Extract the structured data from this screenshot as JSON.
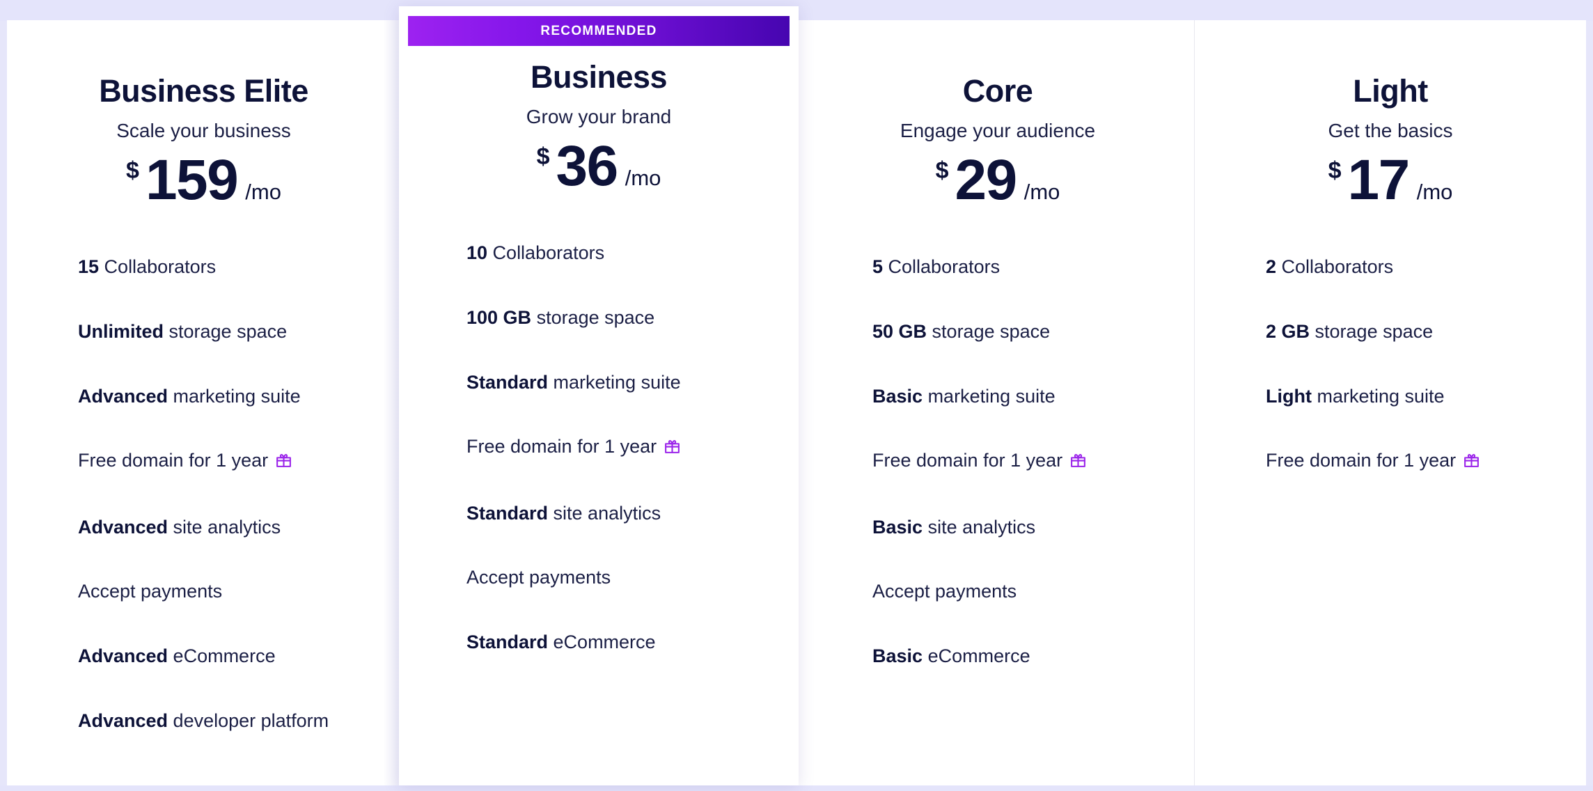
{
  "theme": {
    "page_background": "#e4e4fb",
    "card_background": "#ffffff",
    "text_primary": "#0d1238",
    "text_body": "#1b1f45",
    "ribbon_gradient_start": "#9d22f0",
    "ribbon_gradient_end": "#4605b0",
    "gift_icon_color": "#9b24ea"
  },
  "ribbon": {
    "label": "RECOMMENDED"
  },
  "plans": [
    {
      "id": "business-elite",
      "name": "Business Elite",
      "tagline": "Scale your business",
      "currency": "$",
      "price": "159",
      "period": "/mo",
      "recommended": false,
      "features": [
        {
          "lead": "15",
          "rest": " Collaborators",
          "gift": false
        },
        {
          "lead": "Unlimited",
          "rest": " storage space",
          "gift": false
        },
        {
          "lead": "Advanced",
          "rest": " marketing suite",
          "gift": false
        },
        {
          "lead": "",
          "rest": "Free domain for 1 year",
          "gift": true
        },
        {
          "lead": "Advanced",
          "rest": " site analytics",
          "gift": false
        },
        {
          "lead": "",
          "rest": "Accept payments",
          "gift": false
        },
        {
          "lead": "Advanced",
          "rest": " eCommerce",
          "gift": false
        },
        {
          "lead": "Advanced",
          "rest": " developer platform",
          "gift": false
        }
      ]
    },
    {
      "id": "business",
      "name": "Business",
      "tagline": "Grow your brand",
      "currency": "$",
      "price": "36",
      "period": "/mo",
      "recommended": true,
      "features": [
        {
          "lead": "10",
          "rest": " Collaborators",
          "gift": false
        },
        {
          "lead": "100 GB",
          "rest": " storage space",
          "gift": false
        },
        {
          "lead": "Standard",
          "rest": " marketing suite",
          "gift": false
        },
        {
          "lead": "",
          "rest": "Free domain for 1 year",
          "gift": true
        },
        {
          "lead": "Standard",
          "rest": " site analytics",
          "gift": false
        },
        {
          "lead": "",
          "rest": "Accept payments",
          "gift": false
        },
        {
          "lead": "Standard",
          "rest": " eCommerce",
          "gift": false
        }
      ]
    },
    {
      "id": "core",
      "name": "Core",
      "tagline": "Engage your audience",
      "currency": "$",
      "price": "29",
      "period": "/mo",
      "recommended": false,
      "features": [
        {
          "lead": "5",
          "rest": " Collaborators",
          "gift": false
        },
        {
          "lead": "50 GB",
          "rest": " storage space",
          "gift": false
        },
        {
          "lead": "Basic",
          "rest": " marketing suite",
          "gift": false
        },
        {
          "lead": "",
          "rest": "Free domain for 1 year",
          "gift": true
        },
        {
          "lead": "Basic",
          "rest": " site analytics",
          "gift": false
        },
        {
          "lead": "",
          "rest": "Accept payments",
          "gift": false
        },
        {
          "lead": "Basic",
          "rest": " eCommerce",
          "gift": false
        }
      ]
    },
    {
      "id": "light",
      "name": "Light",
      "tagline": "Get the basics",
      "currency": "$",
      "price": "17",
      "period": "/mo",
      "recommended": false,
      "features": [
        {
          "lead": "2",
          "rest": " Collaborators",
          "gift": false
        },
        {
          "lead": "2 GB",
          "rest": " storage space",
          "gift": false
        },
        {
          "lead": "Light",
          "rest": " marketing suite",
          "gift": false
        },
        {
          "lead": "",
          "rest": "Free domain for 1 year",
          "gift": true
        }
      ]
    }
  ],
  "icons": {
    "gift": "gift-icon"
  }
}
